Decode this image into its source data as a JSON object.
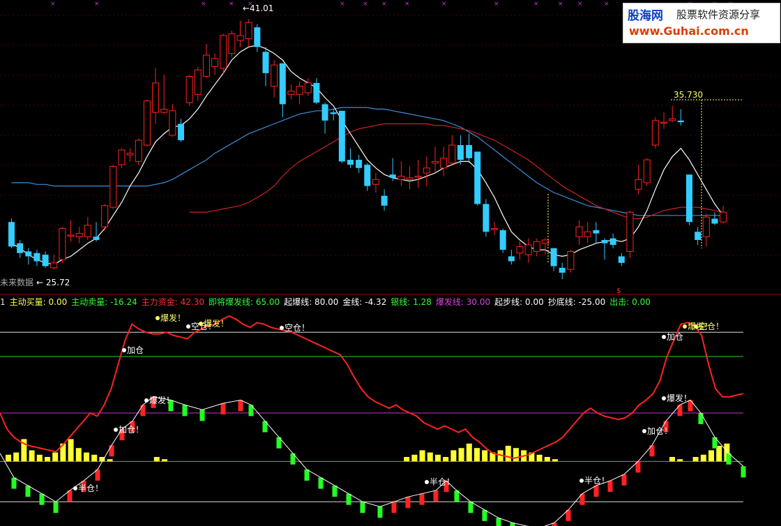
{
  "header": [
    {
      "text": "1",
      "color": "#dddddd"
    },
    {
      "text": "主动买量: 0.00",
      "color": "#ffff55"
    },
    {
      "text": "主动卖量: -16.24",
      "color": "#33ff33"
    },
    {
      "text": "主力资金: 42.30",
      "color": "#ff3333"
    },
    {
      "text": "即将爆发线: 65.00",
      "color": "#33ff33"
    },
    {
      "text": "起爆线: 80.00",
      "color": "#ffffff"
    },
    {
      "text": "金线: -4.32",
      "color": "#ffffff"
    },
    {
      "text": "银线: 1.28",
      "color": "#33ff33"
    },
    {
      "text": "爆发线: 30.00",
      "color": "#dd44dd"
    },
    {
      "text": "起步线: 0.00",
      "color": "#ffffff"
    },
    {
      "text": "抄底线: -25.00",
      "color": "#ffffff"
    },
    {
      "text": "出击: 0.00",
      "color": "#33ff33"
    }
  ],
  "watermark": {
    "brand": "股海网",
    "slogan": "股票软件资源分享",
    "url": "www.Guhai.com.cn"
  },
  "chart_data": [
    {
      "type": "candlestick",
      "annotations": {
        "high_label": "41.01",
        "low_label": "25.72",
        "right_high_label": "35.730",
        "future_label": "未来数据"
      },
      "colors": {
        "up": "#ff2222",
        "down": "#33ccff",
        "ma_short": "#ffffff",
        "ma_mid": "#cc2222",
        "ma_long": "#3a8fd8",
        "grid": "#a00000"
      },
      "candles": [
        [
          28.6,
          28.8,
          27.0,
          27.1
        ],
        [
          27.3,
          27.5,
          26.4,
          26.7
        ],
        [
          26.8,
          27.0,
          26.0,
          26.5
        ],
        [
          26.7,
          26.9,
          25.9,
          26.2
        ],
        [
          26.6,
          26.8,
          25.8,
          25.9
        ],
        [
          25.8,
          26.6,
          25.7,
          26.1
        ],
        [
          26.3,
          28.3,
          26.1,
          28.2
        ],
        [
          27.8,
          28.7,
          27.4,
          27.8
        ],
        [
          27.7,
          28.3,
          27.3,
          27.9
        ],
        [
          27.7,
          28.9,
          27.5,
          28.4
        ],
        [
          27.7,
          28.6,
          27.4,
          27.5
        ],
        [
          28.3,
          29.7,
          28.1,
          29.6
        ],
        [
          29.5,
          32.1,
          29.4,
          32.0
        ],
        [
          32.1,
          33.1,
          31.9,
          33.0
        ],
        [
          32.7,
          33.1,
          32.3,
          32.8
        ],
        [
          32.3,
          33.7,
          32.1,
          33.6
        ],
        [
          33.3,
          36.1,
          33.2,
          36.0
        ],
        [
          35.3,
          38.0,
          34.6,
          37.1
        ],
        [
          35.3,
          37.6,
          35.2,
          35.5
        ],
        [
          33.9,
          35.8,
          33.8,
          35.4
        ],
        [
          34.6,
          34.9,
          33.5,
          33.6
        ],
        [
          35.9,
          37.6,
          35.7,
          37.5
        ],
        [
          36.4,
          38.1,
          36.0,
          37.9
        ],
        [
          37.5,
          39.5,
          37.4,
          38.8
        ],
        [
          38.1,
          38.9,
          37.6,
          38.6
        ],
        [
          38.0,
          40.1,
          37.7,
          40.0
        ],
        [
          38.9,
          40.3,
          38.7,
          40.1
        ],
        [
          39.7,
          40.9,
          39.3,
          40.0
        ],
        [
          39.8,
          41.0,
          39.3,
          40.8
        ],
        [
          40.5,
          40.7,
          39.0,
          39.3
        ],
        [
          39.0,
          39.3,
          36.9,
          37.7
        ],
        [
          36.9,
          38.5,
          36.2,
          38.2
        ],
        [
          38.3,
          38.3,
          35.0,
          35.8
        ],
        [
          36.4,
          37.0,
          36.1,
          36.6
        ],
        [
          36.4,
          37.2,
          35.8,
          36.9
        ],
        [
          36.5,
          37.4,
          36.3,
          37.1
        ],
        [
          37.1,
          37.4,
          35.8,
          35.9
        ],
        [
          35.8,
          35.9,
          34.0,
          34.8
        ],
        [
          35.3,
          35.5,
          34.8,
          35.2
        ],
        [
          35.4,
          35.4,
          32.2,
          32.3
        ],
        [
          32.4,
          33.1,
          31.9,
          32.1
        ],
        [
          32.4,
          32.7,
          31.6,
          31.9
        ],
        [
          32.1,
          32.2,
          30.5,
          30.8
        ],
        [
          30.9,
          31.6,
          30.4,
          31.2
        ],
        [
          30.2,
          30.6,
          29.3,
          29.6
        ],
        [
          31.5,
          32.5,
          31.1,
          31.3
        ],
        [
          31.2,
          32.3,
          30.8,
          31.4
        ],
        [
          31.2,
          32.0,
          30.6,
          31.3
        ],
        [
          31.4,
          32.4,
          30.7,
          31.4
        ],
        [
          31.6,
          32.6,
          30.8,
          31.9
        ],
        [
          32.2,
          33.2,
          31.6,
          32.3
        ],
        [
          31.9,
          33.2,
          31.4,
          32.5
        ],
        [
          32.2,
          33.9,
          32.1,
          33.3
        ],
        [
          33.3,
          33.9,
          32.1,
          32.4
        ],
        [
          33.3,
          34.0,
          32.2,
          32.5
        ],
        [
          32.9,
          32.9,
          29.6,
          29.7
        ],
        [
          29.7,
          30.0,
          27.7,
          28.0
        ],
        [
          28.2,
          28.6,
          27.8,
          28.2
        ],
        [
          28.1,
          28.2,
          26.7,
          26.9
        ],
        [
          26.5,
          26.9,
          26.0,
          26.2
        ],
        [
          26.7,
          27.4,
          26.3,
          27.1
        ],
        [
          26.6,
          27.6,
          26.1,
          27.2
        ],
        [
          26.8,
          27.6,
          26.5,
          27.4
        ],
        [
          27.3,
          27.6,
          26.6,
          27.5
        ],
        [
          27.0,
          27.0,
          25.6,
          25.9
        ],
        [
          25.8,
          26.1,
          25.1,
          25.5
        ],
        [
          25.7,
          26.9,
          25.5,
          26.8
        ],
        [
          27.7,
          28.7,
          27.2,
          28.3
        ],
        [
          27.7,
          28.6,
          27.3,
          28.0
        ],
        [
          28.1,
          28.6,
          27.3,
          27.9
        ],
        [
          27.5,
          27.6,
          26.3,
          27.3
        ],
        [
          27.6,
          27.9,
          27.0,
          27.2
        ],
        [
          26.5,
          26.7,
          25.9,
          26.1
        ],
        [
          26.8,
          29.3,
          26.4,
          29.2
        ],
        [
          30.6,
          32.1,
          30.3,
          31.2
        ],
        [
          31.0,
          32.5,
          30.8,
          32.4
        ],
        [
          33.3,
          35.0,
          33.1,
          34.8
        ],
        [
          34.7,
          35.3,
          34.3,
          34.7
        ],
        [
          34.8,
          35.7,
          34.7,
          34.9
        ],
        [
          34.8,
          35.5,
          34.5,
          34.7
        ],
        [
          31.5,
          31.5,
          28.4,
          28.6
        ],
        [
          28.0,
          28.3,
          27.2,
          27.5
        ],
        [
          27.7,
          29.1,
          27.1,
          28.9
        ],
        [
          28.8,
          29.2,
          28.4,
          28.5
        ],
        [
          28.6,
          29.6,
          28.5,
          29.2
        ]
      ],
      "ma_short": [
        27.3,
        27.0,
        26.6,
        26.3,
        26.1,
        26.0,
        26.3,
        26.5,
        26.9,
        27.3,
        27.6,
        28.2,
        29.0,
        29.8,
        30.8,
        31.6,
        32.6,
        33.5,
        34.0,
        34.4,
        34.5,
        34.9,
        35.5,
        36.3,
        37.0,
        37.7,
        38.5,
        39.0,
        39.3,
        39.4,
        39.2,
        38.9,
        38.5,
        37.8,
        37.4,
        37.1,
        36.8,
        36.2,
        35.7,
        34.8,
        34.0,
        33.2,
        32.4,
        31.9,
        31.5,
        31.3,
        31.2,
        31.1,
        31.2,
        31.4,
        31.6,
        31.9,
        32.1,
        32.3,
        32.3,
        31.8,
        31.0,
        30.1,
        29.0,
        28.0,
        27.5,
        27.1,
        26.9,
        26.9,
        26.6,
        26.5,
        26.6,
        26.9,
        27.1,
        27.3,
        27.4,
        27.5,
        27.4,
        27.6,
        28.3,
        29.3,
        30.6,
        31.8,
        32.6,
        33.1,
        32.4,
        31.5,
        30.6,
        29.7,
        29.0
      ],
      "ma_mid": [
        null,
        null,
        null,
        null,
        null,
        null,
        null,
        null,
        null,
        null,
        null,
        null,
        null,
        null,
        null,
        null,
        null,
        null,
        null,
        null,
        null,
        29.2,
        29.2,
        29.2,
        29.3,
        29.4,
        29.5,
        29.6,
        29.8,
        30.1,
        30.4,
        30.8,
        31.4,
        31.9,
        32.3,
        32.6,
        32.9,
        33.2,
        33.5,
        33.8,
        34.1,
        34.3,
        34.4,
        34.5,
        34.6,
        34.6,
        34.6,
        34.6,
        34.6,
        34.6,
        34.5,
        34.5,
        34.4,
        34.3,
        34.2,
        34.0,
        33.8,
        33.6,
        33.3,
        33.0,
        32.7,
        32.4,
        32.0,
        31.6,
        31.2,
        30.8,
        30.5,
        30.2,
        29.9,
        29.6,
        29.4,
        29.2,
        29.0,
        28.8,
        28.8,
        28.9,
        29.1,
        29.3,
        29.4,
        29.5,
        29.5,
        29.5,
        29.4,
        29.3,
        29.2
      ],
      "ma_long": [
        31.0,
        31.0,
        31.0,
        30.9,
        30.9,
        30.8,
        30.8,
        30.8,
        30.8,
        30.8,
        30.8,
        30.8,
        30.8,
        30.8,
        30.8,
        30.8,
        30.8,
        30.9,
        31.0,
        31.2,
        31.5,
        31.8,
        32.1,
        32.4,
        32.8,
        33.1,
        33.4,
        33.7,
        34.0,
        34.2,
        34.4,
        34.6,
        34.8,
        35.0,
        35.2,
        35.3,
        35.4,
        35.4,
        35.5,
        35.6,
        35.6,
        35.6,
        35.6,
        35.5,
        35.5,
        35.4,
        35.3,
        35.2,
        35.1,
        35.0,
        34.9,
        34.8,
        34.6,
        34.4,
        34.1,
        33.8,
        33.4,
        33.0,
        32.6,
        32.2,
        31.8,
        31.4,
        31.0,
        30.7,
        30.4,
        30.2,
        30.0,
        29.8,
        29.6,
        29.5,
        29.4,
        29.3,
        29.2,
        29.1,
        29.0,
        29.0,
        29.0,
        29.0,
        29.0,
        29.0,
        29.0,
        29.0,
        29.0,
        29.0,
        29.0
      ]
    },
    {
      "type": "indicator",
      "levels": [
        {
          "label": "起爆线",
          "value": 80
        },
        {
          "label": "即将爆发线",
          "value": 65
        },
        {
          "label": "爆发线",
          "value": 30
        },
        {
          "label": "起步线",
          "value": 0
        },
        {
          "label": "抄底线",
          "value": -25
        }
      ],
      "main_force": [
        30,
        20,
        15,
        12,
        10,
        9,
        8,
        7,
        6,
        10,
        15,
        20,
        25,
        30,
        28,
        35,
        45,
        60,
        75,
        85,
        82,
        80,
        79,
        79,
        80,
        78,
        77,
        76,
        80,
        82,
        84,
        85,
        88,
        90,
        88,
        85,
        83,
        86,
        85,
        83,
        82,
        81,
        80,
        78,
        76,
        74,
        72,
        70,
        68,
        66,
        60,
        52,
        45,
        40,
        37,
        35,
        33,
        35,
        32,
        30,
        28,
        24,
        22,
        20,
        22,
        20,
        18,
        20,
        15,
        12,
        8,
        5,
        4,
        3,
        2,
        3,
        4,
        6,
        8,
        10,
        12,
        15,
        20,
        25,
        30,
        33,
        30,
        28,
        27,
        26,
        27,
        30,
        35,
        38,
        42,
        50,
        65,
        75,
        85,
        86,
        84,
        78,
        60,
        45,
        40,
        40,
        41,
        42
      ],
      "main_force_colors": {
        "line": "#ff2222",
        "bull": "#ff2222",
        "bear": "#22ff22"
      },
      "signals_text": {
        "burst": "爆发！",
        "add": "加仓",
        "add_bang": "加仓！",
        "half": "半仓！",
        "empty": "空仓！",
        "empty_alt": "空仓！"
      },
      "volume_bars": [
        3,
        4,
        10,
        5,
        3,
        2,
        4,
        8,
        10,
        6,
        4,
        3,
        2,
        1,
        0,
        0,
        0,
        0,
        0,
        2,
        1,
        0,
        0,
        0,
        0,
        0,
        0,
        0,
        0,
        0,
        0,
        0,
        0,
        0,
        0,
        0,
        0,
        0,
        0,
        0,
        0,
        0,
        0,
        0,
        0,
        0,
        0,
        0,
        0,
        0,
        0,
        2,
        3,
        5,
        4,
        3,
        2,
        5,
        6,
        8,
        6,
        5,
        4,
        5,
        7,
        6,
        5,
        4,
        3,
        2,
        1,
        0,
        0,
        0,
        0,
        0,
        0,
        0,
        0,
        0,
        0,
        0,
        0,
        0,
        0,
        2,
        1,
        0,
        2,
        3,
        5,
        7,
        8,
        0,
        0,
        0,
        0,
        0,
        0,
        0
      ],
      "volume_color": "#ffff33",
      "level_colors": {
        "80": "#dddddd",
        "65": "#33cc33",
        "30": "#cc33cc",
        "0": "#33cc33",
        "-25": "#dddddd"
      }
    }
  ]
}
